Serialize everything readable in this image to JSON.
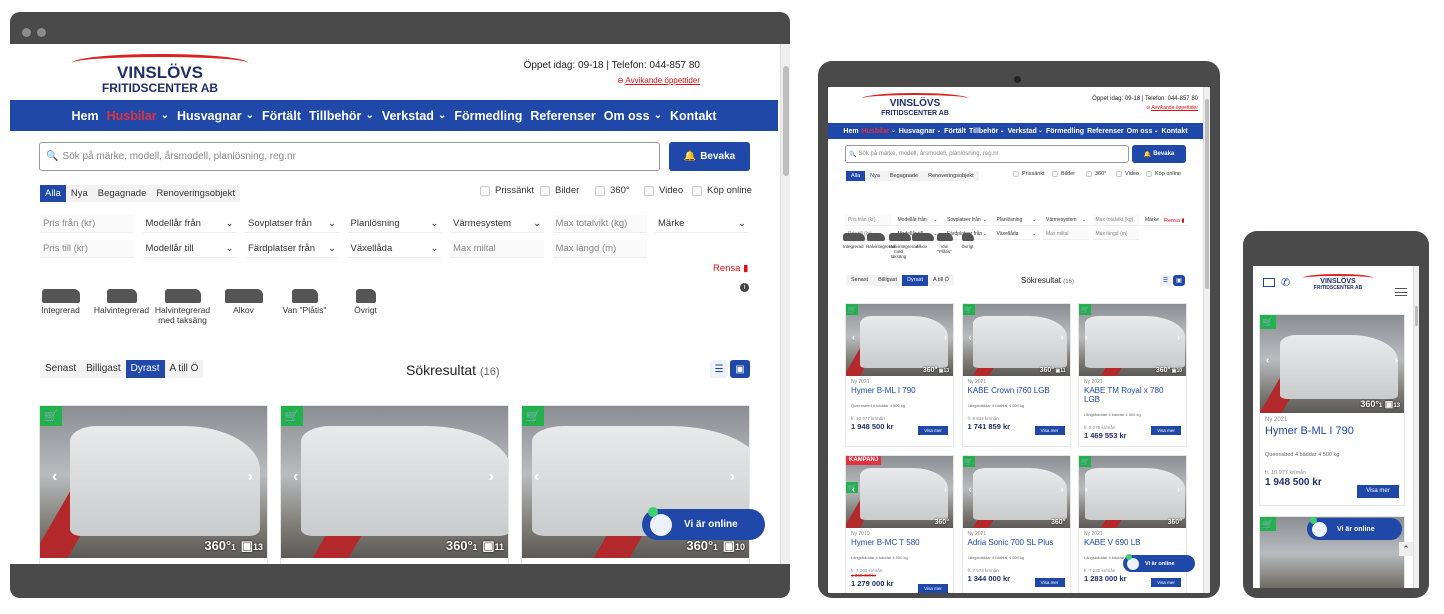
{
  "site": {
    "logo_top": "VINSLÖVS",
    "logo_bottom": "FRITIDSCENTER AB",
    "hours": "Öppet idag: 09-18 | Telefon: 044-857 80",
    "deviating_hours": "Avvikande öppettider"
  },
  "nav": [
    "Hem",
    "Husbilar",
    "Husvagnar",
    "Förtält",
    "Tillbehör",
    "Verkstad",
    "Förmedling",
    "Referenser",
    "Om oss",
    "Kontakt"
  ],
  "nav_dropdown_markers": [
    "",
    "⌄",
    "⌄",
    "",
    "⌄",
    "⌄",
    "",
    "",
    "⌄",
    ""
  ],
  "search": {
    "placeholder": "Sök på märke, modell, årsmodell, planlösning, reg.nr",
    "bevaka_label": "Bevaka"
  },
  "condition_tabs": [
    "Alla",
    "Nya",
    "Begagnade",
    "Renoveringsobjekt"
  ],
  "feature_checks": [
    "Prissänkt",
    "Bilder",
    "360°",
    "Video",
    "Köp online"
  ],
  "filters_row1": [
    "Pris från (kr)",
    "Modellår från",
    "Sovplatser från",
    "Planlösning",
    "Värmesystem",
    "Max totalvikt (kg)",
    "Märke"
  ],
  "filters_row2": [
    "Pris till (kr)",
    "Modellår till",
    "Färdplatser från",
    "Växellåda",
    "Max miltal",
    "Max längd (m)"
  ],
  "rensa_label": "Rensa",
  "vehicle_types": [
    "Integrerad",
    "Halvintegrerad",
    "Halvintegrerad med taksäng",
    "Alkov",
    "Van \"Plåtis\"",
    "Övrigt"
  ],
  "sort_tabs": [
    "Senast",
    "Billigast",
    "Dyrast",
    "A till Ö"
  ],
  "results": {
    "label": "Sökresultat",
    "count": "(16)"
  },
  "chat_label": "Vi är online",
  "laptop_cards": [
    {
      "badge": "360°",
      "b1": "1",
      "b2": "13"
    },
    {
      "badge": "360°",
      "b1": "1",
      "b2": "11"
    },
    {
      "badge": "360°",
      "b1": "1",
      "b2": "10"
    }
  ],
  "tablet_cards": [
    {
      "yr": "Ny 2021",
      "title": "Hymer B-ML I 790",
      "meta": "Queensbed  4 bäddar  4 500 kg",
      "mon": "fr. 10 977 kr/mån",
      "old": "",
      "price": "1 948 500 kr",
      "b2": "13",
      "kampanj": ""
    },
    {
      "yr": "Ny 2021",
      "title": "KABE Crown i760 LGB",
      "meta": "Längsbäddar  4 bäddar  4 500 kg",
      "mon": "fr. 9 812 kr/mån",
      "old": "",
      "price": "1 741 859 kr",
      "b2": "11",
      "kampanj": ""
    },
    {
      "yr": "Ny 2021",
      "title": "KABE TM Royal x 780 LGB",
      "meta": "Längsbäddar  4 bäddar  4 500 kg",
      "mon": "fr. 8 278 kr/mån",
      "old": "",
      "price": "1 469 553 kr",
      "b2": "10",
      "kampanj": ""
    },
    {
      "yr": "Ny 2019",
      "title": "Hymer B-MC T 580",
      "meta": "Längsbäddar  4 bäddar  4 500 kg",
      "mon": "fr. 7 200 kr/mån",
      "old": "1 368 000 kr",
      "price": "1 279 000 kr",
      "b2": "",
      "kampanj": "KAMPANJ"
    },
    {
      "yr": "Ny 2021",
      "title": "Adria Sonic 700 SL Plus",
      "meta": "Längsbäddar  4 bäddar  4 500 kg",
      "mon": "fr. 7 573 kr/mån",
      "old": "",
      "price": "1 344 000 kr",
      "b2": "",
      "kampanj": ""
    },
    {
      "yr": "Ny 2021",
      "title": "KABE V 690 LB",
      "meta": "Längsbäddar  4 bäddar  4 500 kg",
      "mon": "fr. 7 230 kr/mån",
      "old": "",
      "price": "1 283 000 kr",
      "b2": "",
      "kampanj": ""
    }
  ],
  "vm_label": "Visa mer",
  "phone_card": {
    "yr": "Ny 2021",
    "title": "Hymer B-ML I 790",
    "meta": "Queensbed  4 bäddar  4 500 kg",
    "mon": "fr. 10 977 kr/mån",
    "price": "1 948 500 kr",
    "badge": "360°",
    "b1": "1",
    "b2": "13"
  },
  "colors": {
    "brand_blue": "#1f48a8",
    "accent_red": "#e4313f",
    "device_frame": "#4a4a4a",
    "cart_green": "#22b14c"
  }
}
